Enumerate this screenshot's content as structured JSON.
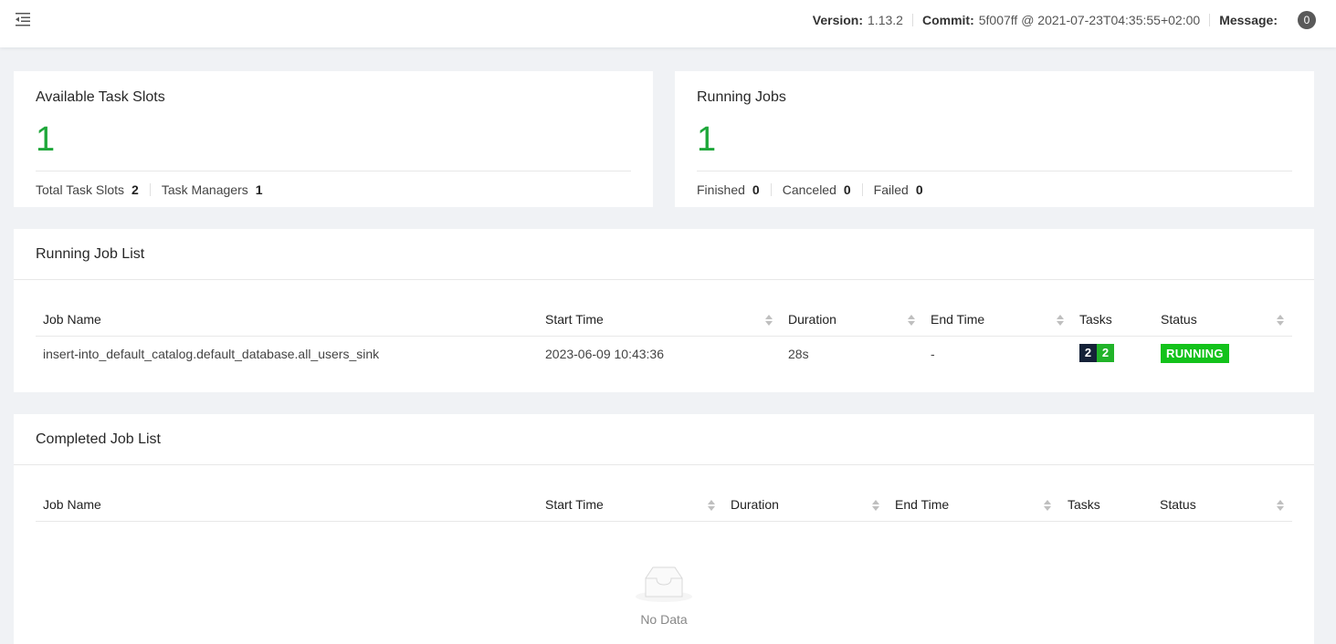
{
  "header": {
    "version_label": "Version:",
    "version_value": "1.13.2",
    "commit_label": "Commit:",
    "commit_value": "5f007ff @ 2021-07-23T04:35:55+02:00",
    "message_label": "Message:",
    "message_count": "0"
  },
  "task_slots": {
    "title": "Available Task Slots",
    "value": "1",
    "total_label": "Total Task Slots",
    "total_value": "2",
    "managers_label": "Task Managers",
    "managers_value": "1"
  },
  "running_jobs": {
    "title": "Running Jobs",
    "value": "1",
    "finished_label": "Finished",
    "finished_value": "0",
    "canceled_label": "Canceled",
    "canceled_value": "0",
    "failed_label": "Failed",
    "failed_value": "0"
  },
  "running_list": {
    "title": "Running Job List",
    "columns": [
      "Job Name",
      "Start Time",
      "Duration",
      "End Time",
      "Tasks",
      "Status"
    ],
    "rows": [
      {
        "job_name": "insert-into_default_catalog.default_database.all_users_sink",
        "start_time": "2023-06-09 10:43:36",
        "duration": "28s",
        "end_time": "-",
        "tasks_dark": "2",
        "tasks_green": "2",
        "status": "RUNNING"
      }
    ]
  },
  "completed_list": {
    "title": "Completed Job List",
    "columns": [
      "Job Name",
      "Start Time",
      "Duration",
      "End Time",
      "Tasks",
      "Status"
    ],
    "empty_text": "No Data"
  },
  "colors": {
    "accent_green": "#1ea73a",
    "status_running": "#13c21b",
    "task_dark": "#152238"
  }
}
